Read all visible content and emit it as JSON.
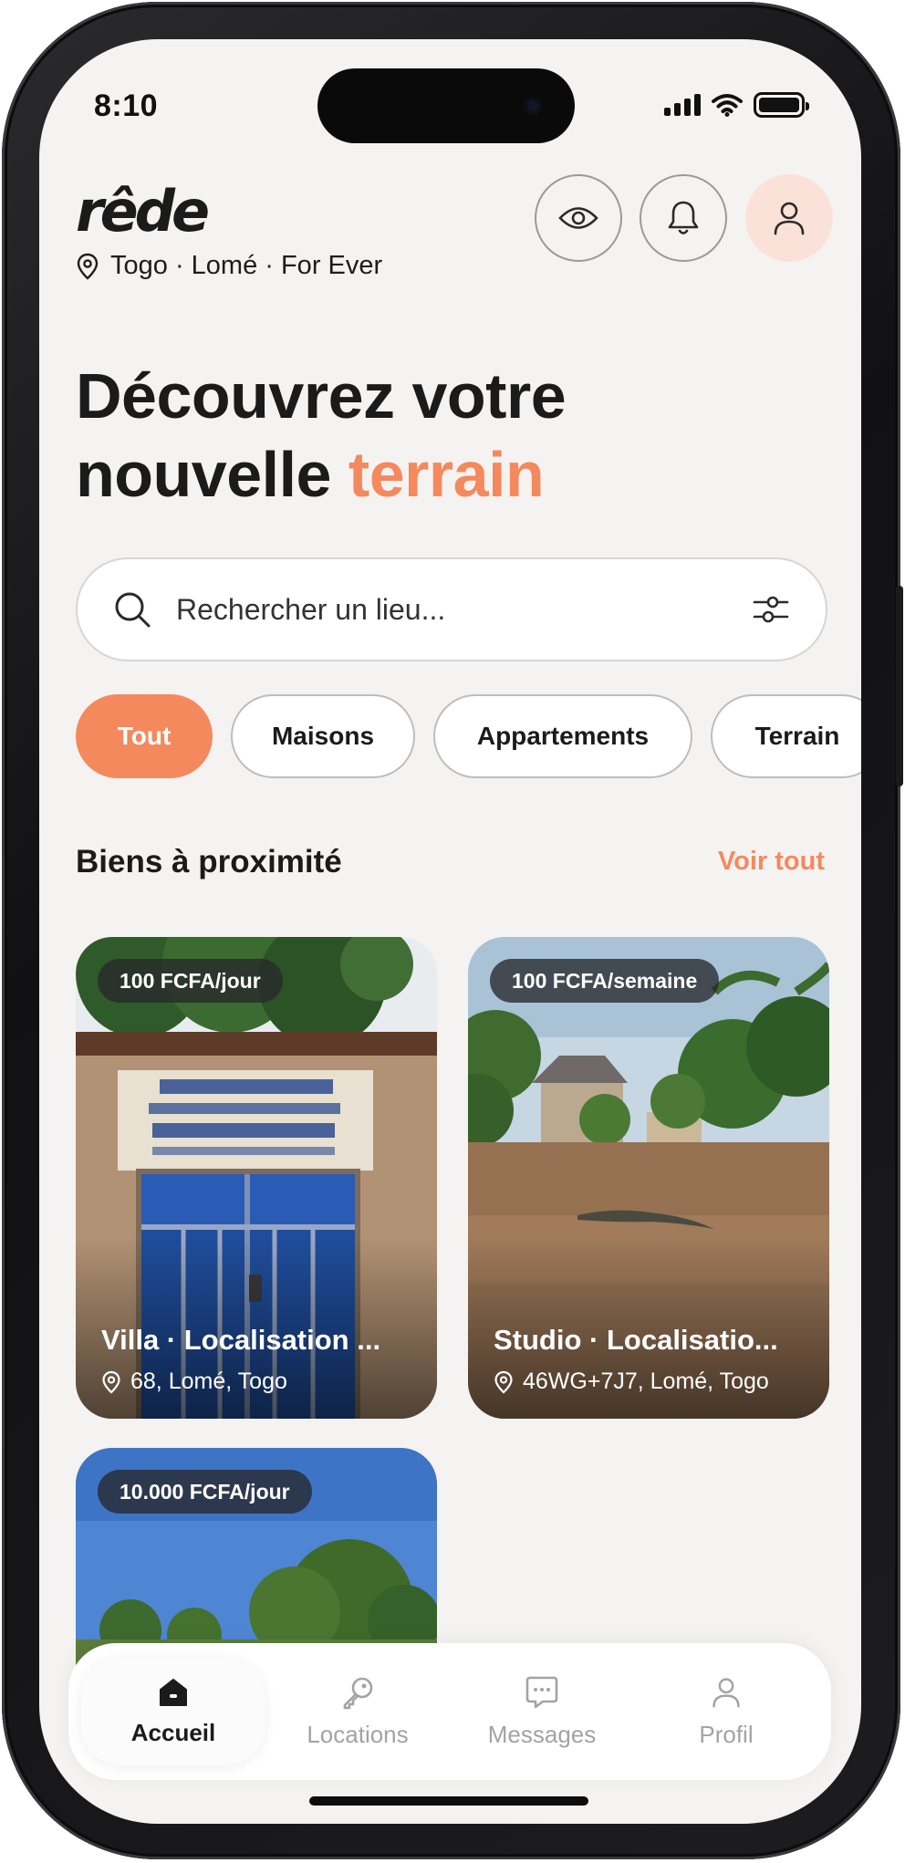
{
  "status_bar": {
    "time": "8:10"
  },
  "header": {
    "logo": "rêde",
    "location": "Togo · Lomé · For Ever",
    "icons": [
      "eye-icon",
      "bell-icon",
      "user-icon"
    ]
  },
  "hero": {
    "line1": "Découvrez votre",
    "line2_prefix": "nouvelle ",
    "line2_accent": "terrain"
  },
  "search": {
    "placeholder": "Rechercher un lieu..."
  },
  "chips": [
    "Tout",
    "Maisons",
    "Appartements",
    "Terrain"
  ],
  "section": {
    "title": "Biens à proximité",
    "see_all": "Voir tout"
  },
  "cards": [
    {
      "price": "100 FCFA/jour",
      "title": "Villa · Localisation ...",
      "address": "68, Lomé, Togo"
    },
    {
      "price": "100 FCFA/semaine",
      "title": "Studio · Localisatio...",
      "address": "46WG+7J7, Lomé, Togo"
    },
    {
      "price": "10.000 FCFA/jour",
      "title": "",
      "address": ""
    }
  ],
  "nav": [
    "Accueil",
    "Locations",
    "Messages",
    "Profil"
  ],
  "colors": {
    "accent": "#f5895e",
    "accent_soft": "#fbe2d8",
    "background": "#f4f3f1",
    "text": "#1b1b1b"
  }
}
